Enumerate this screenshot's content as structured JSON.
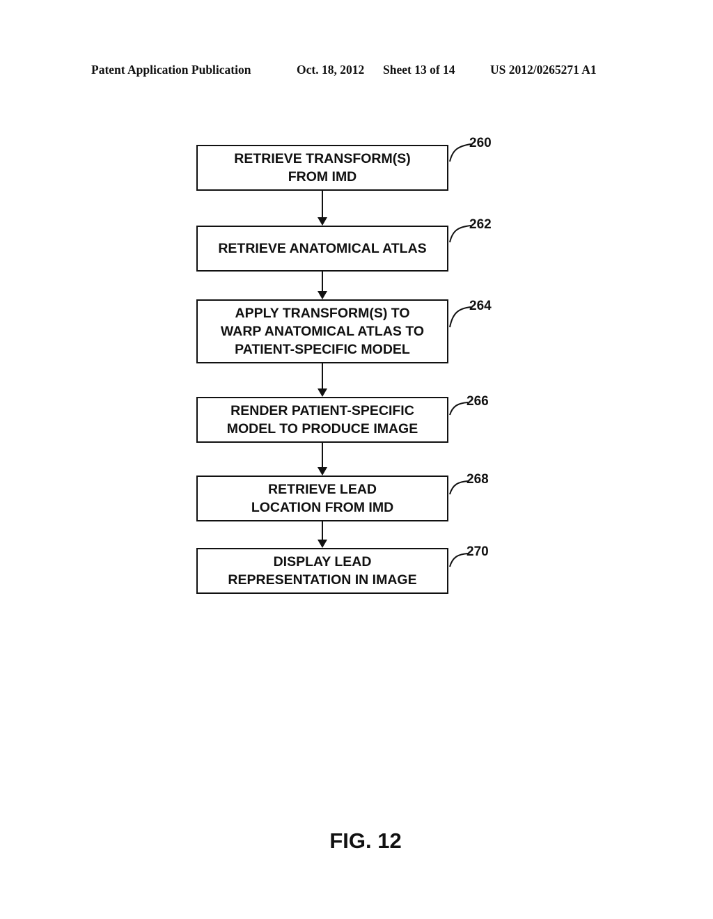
{
  "header": {
    "publication_type": "Patent Application Publication",
    "date": "Oct. 18, 2012",
    "sheet": "Sheet 13 of 14",
    "publication_number": "US 2012/0265271 A1"
  },
  "flowchart": {
    "steps": [
      {
        "ref": "260",
        "text": "RETRIEVE TRANSFORM(S)\nFROM IMD"
      },
      {
        "ref": "262",
        "text": "RETRIEVE ANATOMICAL ATLAS"
      },
      {
        "ref": "264",
        "text": "APPLY TRANSFORM(S) TO\nWARP ANATOMICAL ATLAS TO\nPATIENT-SPECIFIC MODEL"
      },
      {
        "ref": "266",
        "text": "RENDER PATIENT-SPECIFIC\nMODEL TO PRODUCE IMAGE"
      },
      {
        "ref": "268",
        "text": "RETRIEVE LEAD\nLOCATION FROM IMD"
      },
      {
        "ref": "270",
        "text": "DISPLAY LEAD\nREPRESENTATION IN IMAGE"
      }
    ]
  },
  "figure_label": "FIG. 12"
}
